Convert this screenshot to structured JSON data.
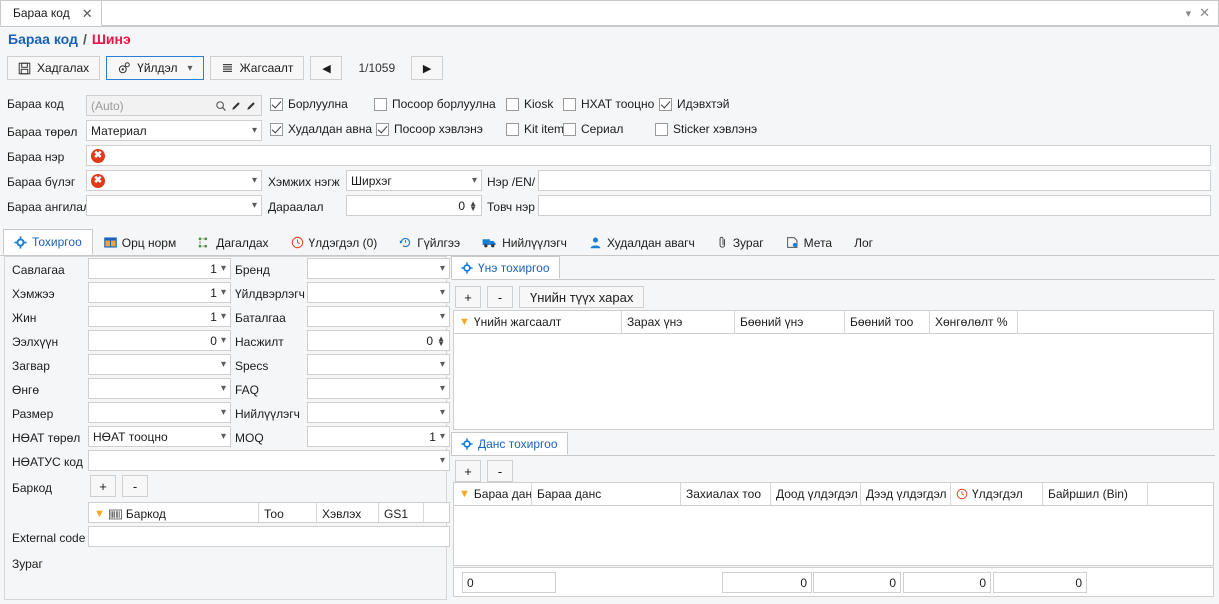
{
  "window": {
    "tab_label": "Бараа код",
    "close_icon": "close-icon",
    "chevron_icon": "chevron-down-icon"
  },
  "breadcrumb": {
    "root": "Бараа код",
    "separator": "/",
    "current": "Шинэ"
  },
  "toolbar": {
    "save_label": "Хадгалах",
    "action_label": "Үйлдэл",
    "list_label": "Жагсаалт",
    "prev_label": "◀",
    "next_label": "▶",
    "page_indicator": "1/1059"
  },
  "form": {
    "labels": {
      "code": "Бараа код",
      "type": "Бараа төрөл",
      "name": "Бараа нэр",
      "group": "Бараа бүлэг",
      "category": "Бараа ангилал",
      "unit": "Хэмжих нэгж",
      "order": "Дараалал",
      "name_en": "Нэр /EN/",
      "short_name": "Товч нэр"
    },
    "values": {
      "code_placeholder": "(Auto)",
      "type": "Материал",
      "name": "",
      "group": "",
      "category": "",
      "unit": "Ширхэг",
      "order": "0",
      "name_en": "",
      "short_name": ""
    },
    "checkboxes": [
      {
        "label": "Борлуулна",
        "checked": true
      },
      {
        "label": "Посоор борлуулна",
        "checked": false
      },
      {
        "label": "Kiosk",
        "checked": false
      },
      {
        "label": "НХАТ тооцно",
        "checked": false
      },
      {
        "label": "Идэвхтэй",
        "checked": true
      },
      {
        "label": "Худалдан авна",
        "checked": true
      },
      {
        "label": "Посоор хэвлэнэ",
        "checked": true
      },
      {
        "label": "Kit item",
        "checked": false
      },
      {
        "label": "Сериал",
        "checked": false
      },
      {
        "label": "Sticker хэвлэнэ",
        "checked": false
      }
    ]
  },
  "main_tabs": [
    {
      "label": "Тохиргоо",
      "icon": "gear-icon",
      "active": true
    },
    {
      "label": "Орц норм",
      "icon": "table-icon",
      "active": false
    },
    {
      "label": "Дагалдах",
      "icon": "hierarchy-icon",
      "active": false
    },
    {
      "label": "Үлдэгдэл (0)",
      "icon": "clock-icon",
      "active": false
    },
    {
      "label": "Гүйлгээ",
      "icon": "history-icon",
      "active": false
    },
    {
      "label": "Нийлүүлэгч",
      "icon": "truck-icon",
      "active": false
    },
    {
      "label": "Худалдан авагч",
      "icon": "user-icon",
      "active": false
    },
    {
      "label": "Зураг",
      "icon": "paperclip-icon",
      "active": false
    },
    {
      "label": "Мета",
      "icon": "meta-icon",
      "active": false
    },
    {
      "label": "Лог",
      "icon": "",
      "active": false
    }
  ],
  "settings": {
    "left_fields": [
      {
        "label": "Савлагаа",
        "value": "1"
      },
      {
        "label": "Хэмжээ",
        "value": "1"
      },
      {
        "label": "Жин",
        "value": "1"
      },
      {
        "label": "Ээлхүүн",
        "value": "0"
      },
      {
        "label": "Загвар",
        "value": ""
      },
      {
        "label": "Өнгө",
        "value": ""
      },
      {
        "label": "Размер",
        "value": ""
      },
      {
        "label": "НӨАТ төрөл",
        "value": "НӨАТ тооцно"
      }
    ],
    "right_fields": [
      {
        "label": "Бренд",
        "value": ""
      },
      {
        "label": "Үйлдвэрлэгч",
        "value": ""
      },
      {
        "label": "Баталгаа",
        "value": ""
      },
      {
        "label": "Насжилт",
        "value": "0"
      },
      {
        "label": "Specs",
        "value": ""
      },
      {
        "label": "FAQ",
        "value": ""
      },
      {
        "label": "Нийлүүлэгч",
        "value": ""
      },
      {
        "label": "MOQ",
        "value": "1"
      }
    ],
    "vat_code_label": "НӨАТУС код",
    "vat_code_value": "",
    "barcode_label": "Баркод",
    "barcode_add": "+",
    "barcode_remove": "-",
    "barcode_columns": [
      "Баркод",
      "Тоо",
      "Хэвлэх",
      "GS1",
      ""
    ],
    "external_code_label": "External code",
    "external_code_value": "",
    "image_label": "Зураг"
  },
  "price_card": {
    "title": "Үнэ тохиргоо",
    "icon": "gear-icon",
    "add": "+",
    "remove": "-",
    "history_button": "Үнийн түүх харах",
    "columns": [
      "Үнийн жагсаалт",
      "Зарах үнэ",
      "Бөөний үнэ",
      "Бөөний тоо",
      "Хөнгөлөлт %",
      ""
    ],
    "rows": []
  },
  "account_card": {
    "title": "Данс тохиргоо",
    "icon": "gear-icon",
    "add": "+",
    "remove": "-",
    "columns": [
      "Бараа данс",
      "Бараа данс",
      "Захиалах тоо",
      "Доод үлдэгдэл",
      "Дээд үлдэгдэл",
      "Үлдэгдэл",
      "Байршил (Bin)",
      ""
    ],
    "remainder_icon": "clock-icon",
    "rows": [],
    "footer_values": [
      "0",
      "0",
      "0",
      "0",
      "0"
    ]
  },
  "colors": {
    "link": "#1a62b8",
    "danger": "#e8174a",
    "error": "#e03a16",
    "accent": "#2a7fd4",
    "funnel": "#f5a623"
  }
}
